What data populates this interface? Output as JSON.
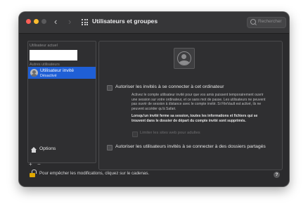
{
  "titlebar": {
    "title": "Utilisateurs et groupes",
    "back_glyph": "‹",
    "forward_glyph": "›",
    "search_placeholder": "Rechercher"
  },
  "sidebar": {
    "current_user_label": "Utilisateur actuel",
    "other_users_label": "Autres utilisateurs",
    "guest_user": {
      "name": "Utilisateur invité",
      "status": "Désactivé"
    },
    "options_label": "Options",
    "add_glyph": "+",
    "remove_glyph": "−"
  },
  "content": {
    "allow_login_label": "Autoriser les invités à se connecter à cet ordinateur",
    "desc_lines": [
      "Activez le compte utilisateur invité pour que vos amis puissent temporairement ouvrir",
      "une session sur votre ordinateur, et ce sans mot de passe. Les utilisateurs ne peuvent",
      "pas ouvrir de session à distance avec le compte invité. Si FileVault est activé, ils ne",
      "peuvent accéder qu'à Safari."
    ],
    "bold_lines": [
      "Lorsqu'un invité ferme sa session, toutes les informations et fichiers qui se",
      "trouvent dans le dossier de départ du compte invité sont supprimés."
    ],
    "limit_sites_label": "Limiter les sites web pour adultes",
    "shared_folders_label": "Autoriser les utilisateurs invités à se connecter à des dossiers partagés"
  },
  "footer": {
    "lock_text": "Pour empêcher les modifications, cliquez sur le cadenas.",
    "help_glyph": "?"
  },
  "colors": {
    "selection": "#1f5fd6",
    "lock": "#e0a800"
  }
}
